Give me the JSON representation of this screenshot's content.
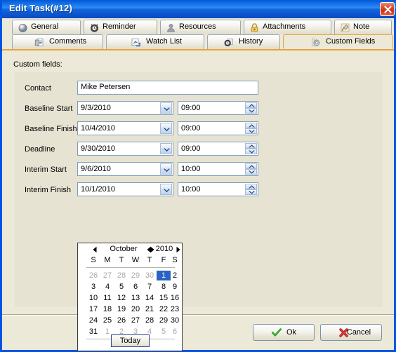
{
  "window": {
    "title": "Edit Task(#12)",
    "close_icon": "close-icon"
  },
  "tabs": {
    "row1": [
      {
        "label": "General",
        "icon": "sphere-icon",
        "selected": false
      },
      {
        "label": "Reminder",
        "icon": "alarm-clock-icon",
        "selected": false
      },
      {
        "label": "Resources",
        "icon": "person-icon",
        "selected": false
      },
      {
        "label": "Attachments",
        "icon": "padlock-icon",
        "selected": false
      },
      {
        "label": "Note",
        "icon": "pushpin-icon",
        "selected": false
      }
    ],
    "row2": [
      {
        "label": "Comments",
        "icon": "comment-list-icon",
        "selected": false
      },
      {
        "label": "Watch List",
        "icon": "binoculars-icon",
        "selected": false
      },
      {
        "label": "History",
        "icon": "clock-icon",
        "selected": false
      },
      {
        "label": "Custom Fields",
        "icon": "gear-icon",
        "selected": true
      }
    ]
  },
  "page": {
    "heading": "Custom fields:"
  },
  "fields": [
    {
      "label": "Contact",
      "type": "text",
      "value": "Mike Petersen"
    },
    {
      "label": "Baseline Start",
      "type": "datetime",
      "date": "9/3/2010",
      "time": "09:00"
    },
    {
      "label": "Baseline Finish",
      "type": "datetime",
      "date": "10/4/2010",
      "time": "09:00"
    },
    {
      "label": "Deadline",
      "type": "datetime",
      "date": "9/30/2010",
      "time": "09:00"
    },
    {
      "label": "Interim Start",
      "type": "datetime",
      "date": "9/6/2010",
      "time": "10:00"
    },
    {
      "label": "Interim Finish",
      "type": "datetime",
      "date": "10/1/2010",
      "time": "10:00"
    }
  ],
  "calendar": {
    "month": "October",
    "year": "2010",
    "selected_day": 1,
    "today_label": "Today",
    "weekday_headers": [
      "S",
      "M",
      "T",
      "W",
      "T",
      "F",
      "S"
    ],
    "weeks": [
      [
        {
          "d": "26",
          "o": true
        },
        {
          "d": "27",
          "o": true
        },
        {
          "d": "28",
          "o": true
        },
        {
          "d": "29",
          "o": true
        },
        {
          "d": "30",
          "o": true
        },
        {
          "d": "1",
          "o": false,
          "sel": true
        },
        {
          "d": "2",
          "o": false
        }
      ],
      [
        {
          "d": "3",
          "o": false
        },
        {
          "d": "4",
          "o": false
        },
        {
          "d": "5",
          "o": false
        },
        {
          "d": "6",
          "o": false
        },
        {
          "d": "7",
          "o": false
        },
        {
          "d": "8",
          "o": false
        },
        {
          "d": "9",
          "o": false
        }
      ],
      [
        {
          "d": "10",
          "o": false
        },
        {
          "d": "11",
          "o": false
        },
        {
          "d": "12",
          "o": false
        },
        {
          "d": "13",
          "o": false
        },
        {
          "d": "14",
          "o": false
        },
        {
          "d": "15",
          "o": false
        },
        {
          "d": "16",
          "o": false
        }
      ],
      [
        {
          "d": "17",
          "o": false
        },
        {
          "d": "18",
          "o": false
        },
        {
          "d": "19",
          "o": false
        },
        {
          "d": "20",
          "o": false
        },
        {
          "d": "21",
          "o": false
        },
        {
          "d": "22",
          "o": false
        },
        {
          "d": "23",
          "o": false
        }
      ],
      [
        {
          "d": "24",
          "o": false
        },
        {
          "d": "25",
          "o": false
        },
        {
          "d": "26",
          "o": false
        },
        {
          "d": "27",
          "o": false
        },
        {
          "d": "28",
          "o": false
        },
        {
          "d": "29",
          "o": false
        },
        {
          "d": "30",
          "o": false
        }
      ],
      [
        {
          "d": "31",
          "o": false
        },
        {
          "d": "1",
          "o": true
        },
        {
          "d": "2",
          "o": true
        },
        {
          "d": "3",
          "o": true
        },
        {
          "d": "4",
          "o": true
        },
        {
          "d": "5",
          "o": true
        },
        {
          "d": "6",
          "o": true
        }
      ]
    ]
  },
  "footer": {
    "ok_label": "Ok",
    "cancel_label": "Cancel"
  },
  "colors": {
    "titlebar_blue": "#0a62e0",
    "selected_tab_orange": "#e8a33d",
    "panel_beige": "#e6e3d2",
    "dialog_beige": "#ece9d8",
    "calendar_selection": "#2b63c4",
    "ok_check_green": "#1a8a1a",
    "cancel_x_red": "#d62020"
  }
}
